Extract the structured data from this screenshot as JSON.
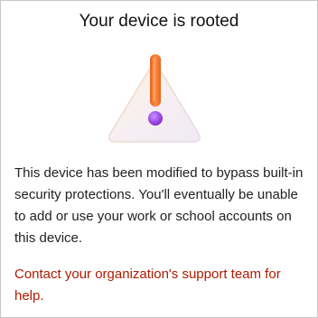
{
  "dialog": {
    "title": "Your device is rooted",
    "illustration_icon": "warning-triangle-exclamation-icon",
    "message": "This device has been modified to bypass built-in security protections. You'll eventually be unable to add or use your work or school accounts on this device.",
    "support_link": "Contact your organization's support team for help."
  },
  "colors": {
    "link": "#b01a00",
    "exclamation_bar": "#f07a2a",
    "exclamation_dot": "#9b4fe0"
  }
}
